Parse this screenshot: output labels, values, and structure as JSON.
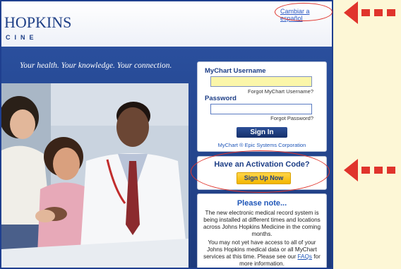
{
  "header": {
    "brand_text": "HOPKINS",
    "brand_sub": "CINE",
    "language_link": "Cambiar a español"
  },
  "banner": {
    "tagline": "Your health. Your knowledge. Your connection."
  },
  "login": {
    "username_label": "MyChart Username",
    "username_value": "",
    "forgot_username": "Forgot MyChart Username?",
    "password_label": "Password",
    "password_value": "",
    "forgot_password": "Forgot Password?",
    "sign_in_button": "Sign In",
    "epic_credit": "MyChart ® Epic Systems Corporation"
  },
  "activation": {
    "title": "Have an Activation Code?",
    "signup_button": "Sign Up Now"
  },
  "note": {
    "title": "Please note...",
    "paragraph1": "The new electronic medical record system is being installed at different times and locations across Johns Hopkins Medicine in the coming months.",
    "paragraph2_before": "You may not yet have access to all of your Johns Hopkins medical data or all MyChart services at this time. Please see our ",
    "faq_link": "FAQs",
    "paragraph2_after": " for more information."
  },
  "annotations": {
    "highlight_color": "#e0342c"
  }
}
